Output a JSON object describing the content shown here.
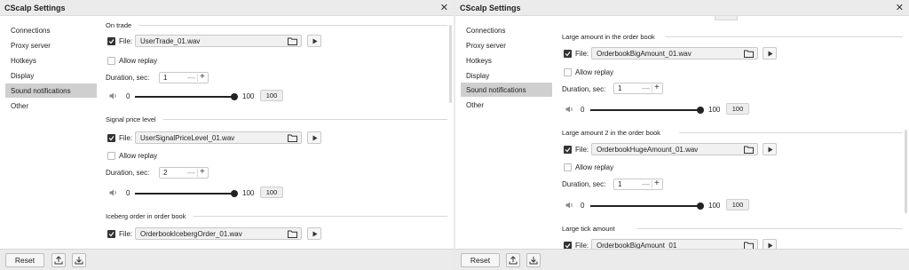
{
  "windows": [
    {
      "title": "CScalp Settings",
      "nav": [
        "Connections",
        "Proxy server",
        "Hotkeys",
        "Display",
        "Sound notifications",
        "Other"
      ],
      "active_nav": "Sound notifications",
      "footer": {
        "reset_label": "Reset"
      },
      "sections": [
        {
          "title": "On trade",
          "file_label": "File:",
          "file": "UserTrade_01.wav",
          "file_checked": true,
          "replay_label": "Allow replay",
          "replay_checked": false,
          "duration_label": "Duration, sec:",
          "duration": "1",
          "vol_min": "0",
          "vol_max": "100",
          "volume": "100"
        },
        {
          "title": "Signal price level",
          "file_label": "File:",
          "file": "UserSignalPriceLevel_01.wav",
          "file_checked": true,
          "replay_label": "Allow replay",
          "replay_checked": false,
          "duration_label": "Duration, sec:",
          "duration": "2",
          "vol_min": "0",
          "vol_max": "100",
          "volume": "100"
        },
        {
          "title": "Iceberg order in order book",
          "file_label": "File:",
          "file": "OrderbookIcebergOrder_01.wav",
          "file_checked": true
        }
      ]
    },
    {
      "title": "CScalp Settings",
      "nav": [
        "Connections",
        "Proxy server",
        "Hotkeys",
        "Display",
        "Sound notifications",
        "Other"
      ],
      "active_nav": "Sound notifications",
      "footer": {
        "reset_label": "Reset"
      },
      "sections": [
        {
          "title": "Large amount in the order book",
          "file_label": "File:",
          "file": "OrderbookBigAmount_01.wav",
          "file_checked": true,
          "replay_label": "Allow replay",
          "replay_checked": false,
          "duration_label": "Duration, sec:",
          "duration": "1",
          "vol_min": "0",
          "vol_max": "100",
          "volume": "100"
        },
        {
          "title": "Large amount 2 in the order book",
          "file_label": "File:",
          "file": "OrderbookHugeAmount_01.wav",
          "file_checked": true,
          "replay_label": "Allow replay",
          "replay_checked": false,
          "duration_label": "Duration, sec:",
          "duration": "1",
          "vol_min": "0",
          "vol_max": "100",
          "volume": "100"
        },
        {
          "title": "Large tick amount",
          "file_label": "File:",
          "file": "OrderbookBigAmount_01",
          "file_checked": true
        }
      ]
    }
  ],
  "colors": {
    "titlebar": "#ebebeb",
    "active_nav": "#cfcfcf",
    "control_dark": "#222222"
  },
  "icons": [
    "close-icon",
    "folder-icon",
    "play-icon",
    "volume-icon",
    "check-icon",
    "upload-icon",
    "download-icon"
  ]
}
